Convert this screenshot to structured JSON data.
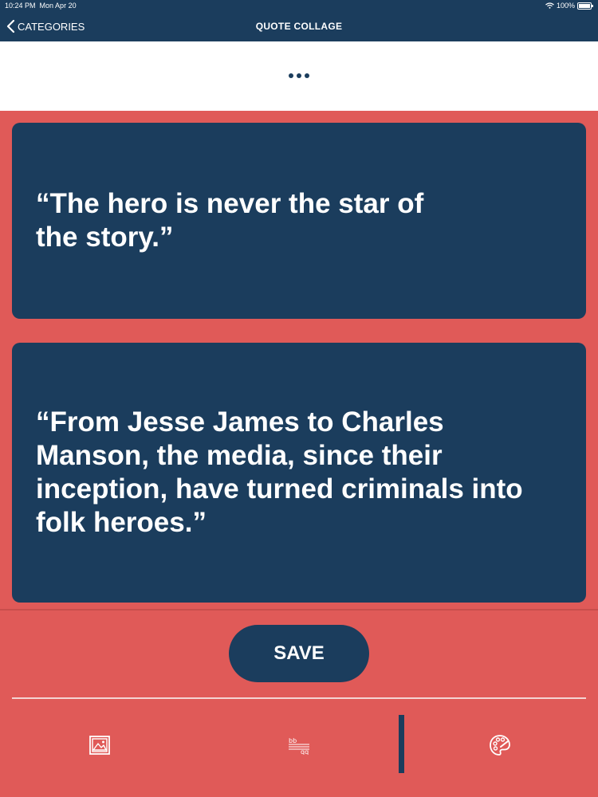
{
  "status_bar": {
    "time": "10:24 PM",
    "date": "Mon Apr 20",
    "battery": "100%",
    "icons": [
      "wifi-icon",
      "battery-icon"
    ]
  },
  "nav": {
    "back_label": "CATEGORIES",
    "title": "QUOTE COLLAGE",
    "back_icon": "chevron-left-icon"
  },
  "toolbar": {
    "more_icon": "ellipsis-icon"
  },
  "quotes": [
    {
      "text": "“The hero is never the star of the story.”"
    },
    {
      "text": "“From Jesse James to Charles Manson, the media, since their inception, have turned criminals into folk heroes.”"
    }
  ],
  "actions": {
    "save_label": "SAVE"
  },
  "tabs": [
    {
      "icon": "image-icon"
    },
    {
      "icon": "text-format-icon"
    },
    {
      "icon": "palette-icon"
    }
  ],
  "colors": {
    "background": "#e05a58",
    "card": "#1b3d5d",
    "navbar": "#1b3d5d",
    "text": "#ffffff"
  }
}
